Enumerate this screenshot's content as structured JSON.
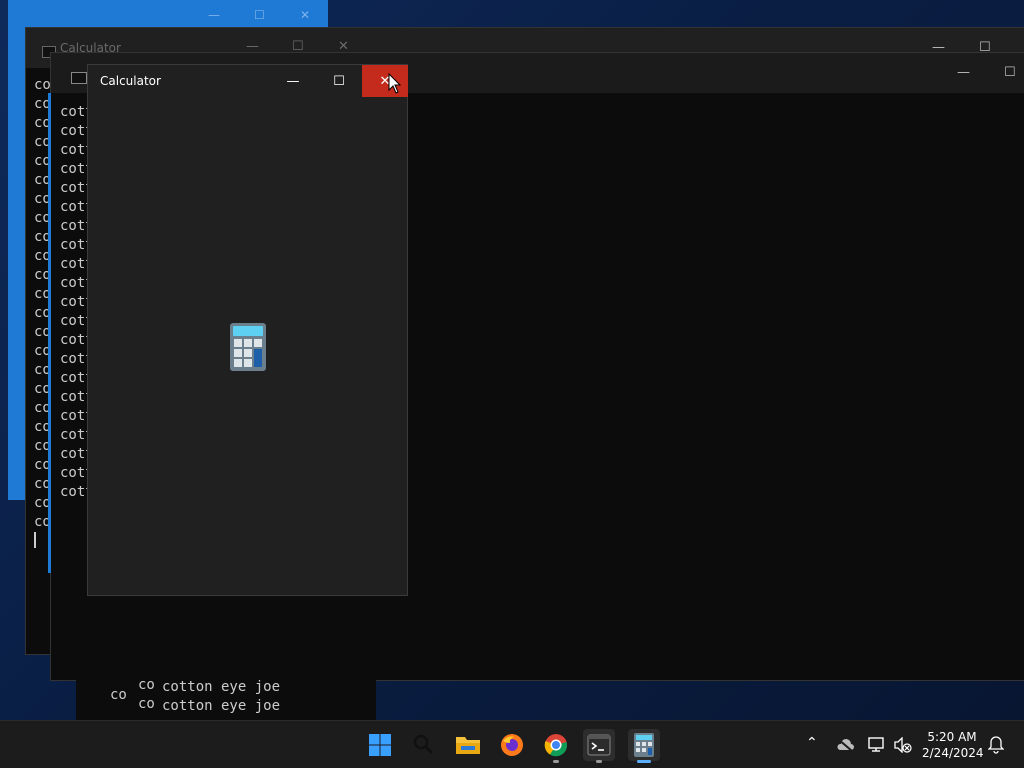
{
  "background_windows": {
    "calculator_ghost_title": "Calculator",
    "terminal_line_prefix_a": "co",
    "terminal_line_prefix_b": "cot",
    "terminal_line": "cotton eye joe",
    "line_count_a": 24,
    "line_count_b": 21
  },
  "calculator": {
    "title": "Calculator",
    "minimize_label": "—",
    "maximize_label": "☐",
    "close_label": "✕"
  },
  "taskbar": {
    "apps": [
      {
        "name": "Start",
        "icon": "windows-start-icon"
      },
      {
        "name": "Search",
        "icon": "search-icon"
      },
      {
        "name": "File Explorer",
        "icon": "folder-icon"
      },
      {
        "name": "Firefox",
        "icon": "firefox-icon"
      },
      {
        "name": "Chrome",
        "icon": "chrome-icon"
      },
      {
        "name": "Terminal",
        "icon": "terminal-icon"
      },
      {
        "name": "Calculator",
        "icon": "calculator-icon"
      }
    ],
    "clock": {
      "time": "5:20 AM",
      "date": "2/24/2024"
    }
  },
  "colors": {
    "close_hover": "#c42b1c",
    "accent_blue": "#1f7ad6",
    "terminal_bg": "#0c0c0c",
    "taskbar_bg": "#1c1c1c"
  }
}
